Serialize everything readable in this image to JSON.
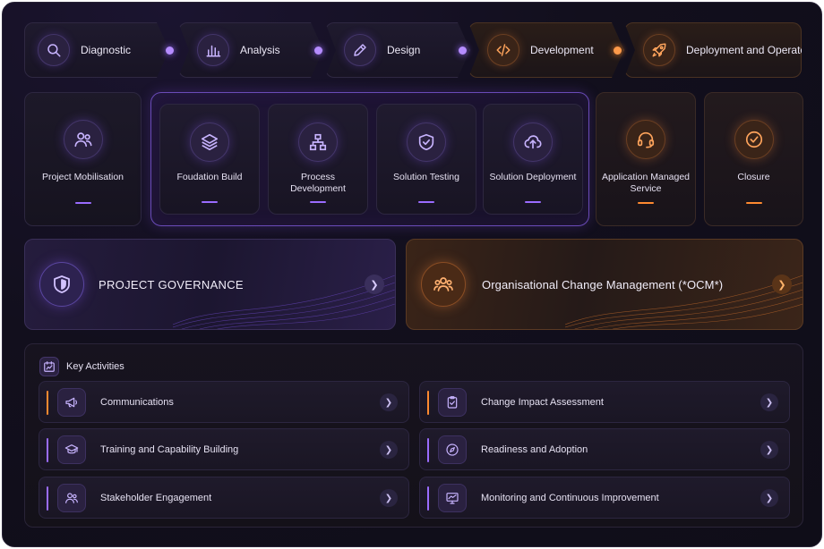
{
  "phases": [
    {
      "label": "Diagnostic",
      "icon": "search-icon",
      "tone": "purple"
    },
    {
      "label": "Analysis",
      "icon": "bar-chart-icon",
      "tone": "purple"
    },
    {
      "label": "Design",
      "icon": "pencil-icon",
      "tone": "purple"
    },
    {
      "label": "Development",
      "icon": "code-icon",
      "tone": "orange"
    },
    {
      "label": "Deployment and Operate",
      "icon": "rocket-icon",
      "tone": "orange"
    }
  ],
  "steps": [
    {
      "label": "Project Mobilisation",
      "icon": "users-icon",
      "tone": "purple"
    },
    {
      "label": "Foudation Build",
      "icon": "layers-icon",
      "tone": "purple"
    },
    {
      "label": "Process Development",
      "icon": "sitemap-icon",
      "tone": "purple"
    },
    {
      "label": "Solution Testing",
      "icon": "shield-check-icon",
      "tone": "purple"
    },
    {
      "label": "Solution Deployment",
      "icon": "cloud-upload-icon",
      "tone": "purple"
    },
    {
      "label": "Application Managed Service",
      "icon": "headset-icon",
      "tone": "orange"
    },
    {
      "label": "Closure",
      "icon": "check-circle-icon",
      "tone": "orange"
    }
  ],
  "banners": {
    "governance": {
      "title": "PROJECT GOVERNANCE",
      "icon": "shield-icon",
      "tone": "purple"
    },
    "ocm": {
      "title": "Organisational Change Management (*OCM*)",
      "icon": "users-group-icon",
      "tone": "orange"
    }
  },
  "activities": {
    "title": "Key Activities",
    "icon": "calendar-chart-icon",
    "items": [
      {
        "label": "Communications",
        "icon": "megaphone-icon",
        "accent": "orange"
      },
      {
        "label": "Change Impact Assessment",
        "icon": "clipboard-check-icon",
        "accent": "orange"
      },
      {
        "label": "Training and Capability Building",
        "icon": "graduation-cap-icon",
        "accent": "purple"
      },
      {
        "label": "Readiness and Adoption",
        "icon": "compass-icon",
        "accent": "purple"
      },
      {
        "label": "Stakeholder Engagement",
        "icon": "people-icon",
        "accent": "purple"
      },
      {
        "label": "Monitoring and Continuous Improvement",
        "icon": "trend-monitor-icon",
        "accent": "purple"
      }
    ]
  },
  "colors": {
    "purple_accent": "#9a6cff",
    "orange_accent": "#ff8a30",
    "background": "#120f1d"
  }
}
